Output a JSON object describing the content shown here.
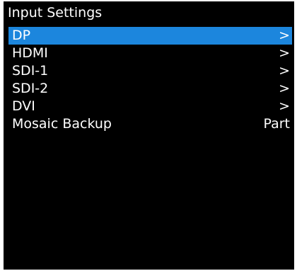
{
  "header": {
    "title": "Input Settings"
  },
  "menu": {
    "items": [
      {
        "label": "DP",
        "value": ">",
        "selected": true
      },
      {
        "label": "HDMI",
        "value": ">",
        "selected": false
      },
      {
        "label": "SDI-1",
        "value": ">",
        "selected": false
      },
      {
        "label": "SDI-2",
        "value": ">",
        "selected": false
      },
      {
        "label": "DVI",
        "value": ">",
        "selected": false
      },
      {
        "label": "Mosaic Backup",
        "value": "Part",
        "selected": false
      }
    ]
  },
  "colors": {
    "background": "#000000",
    "text": "#ffffff",
    "highlight": "#1c86dd"
  }
}
